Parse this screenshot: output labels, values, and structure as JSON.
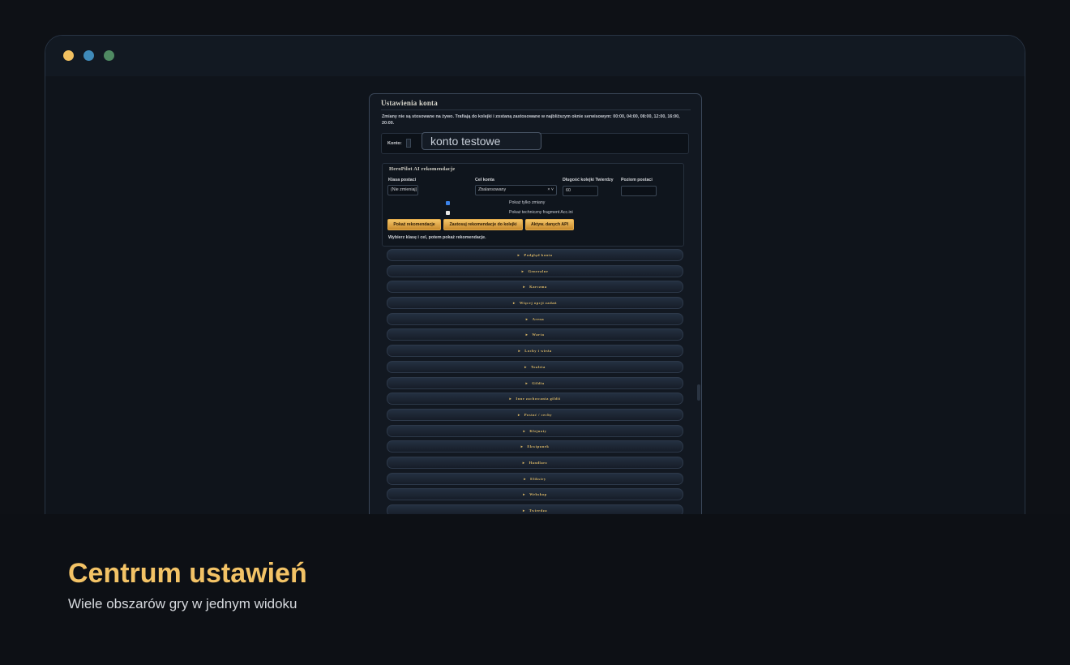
{
  "window": {
    "colors": {
      "close": "#f1c060",
      "minimize": "#3f8ab9",
      "maximize": "#4f8a62"
    }
  },
  "panel": {
    "title": "Ustawienia konta",
    "info": "Zmiany nie są stosowane na żywo. Trafiają do kolejki i zostaną zastosowane w najbliższym oknie serwisowym: 00:00, 04:00, 08:00, 12:00, 16:00, 20:00.",
    "account": {
      "label": "Konto:",
      "value": "konto testowe"
    },
    "heropilot": {
      "title": "HeroPilot AI rekomendacje",
      "class_label": "Klasa postaci",
      "class_value": "(Nie zmieniaj)",
      "goal_label": "Cel konta",
      "goal_value": "Zbalansowany",
      "queue_label": "Długość kolejki Twierdzy",
      "queue_value": "60",
      "level_label": "Poziom postaci",
      "level_value": "",
      "show_changes_only": "Pokaż tylko zmiany",
      "show_acc_ini": "Pokaż techniczny fragment Acc.ini",
      "buttons": {
        "show": "Pokaż rekomendacje",
        "apply": "Zastosuj rekomendacje do kolejki",
        "api": "Aktyw. danych API"
      },
      "hint": "Wybierz klasę i cel, potem pokaż rekomendacje."
    },
    "sections": [
      "Podgląd konta",
      "Generalne",
      "Karczma",
      "Więcej opcji zadań",
      "Arena",
      "Warta",
      "Lochy i wieża",
      "Toaleta",
      "Gildia",
      "Inne zachowania gildii",
      "Postać / cechy",
      "Klejnoty",
      "Ekwipunek",
      "Handlarz",
      "Eliksiry",
      "Webshop",
      "Twierdza"
    ]
  },
  "caption": {
    "title": "Centrum ustawień",
    "subtitle": "Wiele obszarów gry w jednym widoku"
  }
}
